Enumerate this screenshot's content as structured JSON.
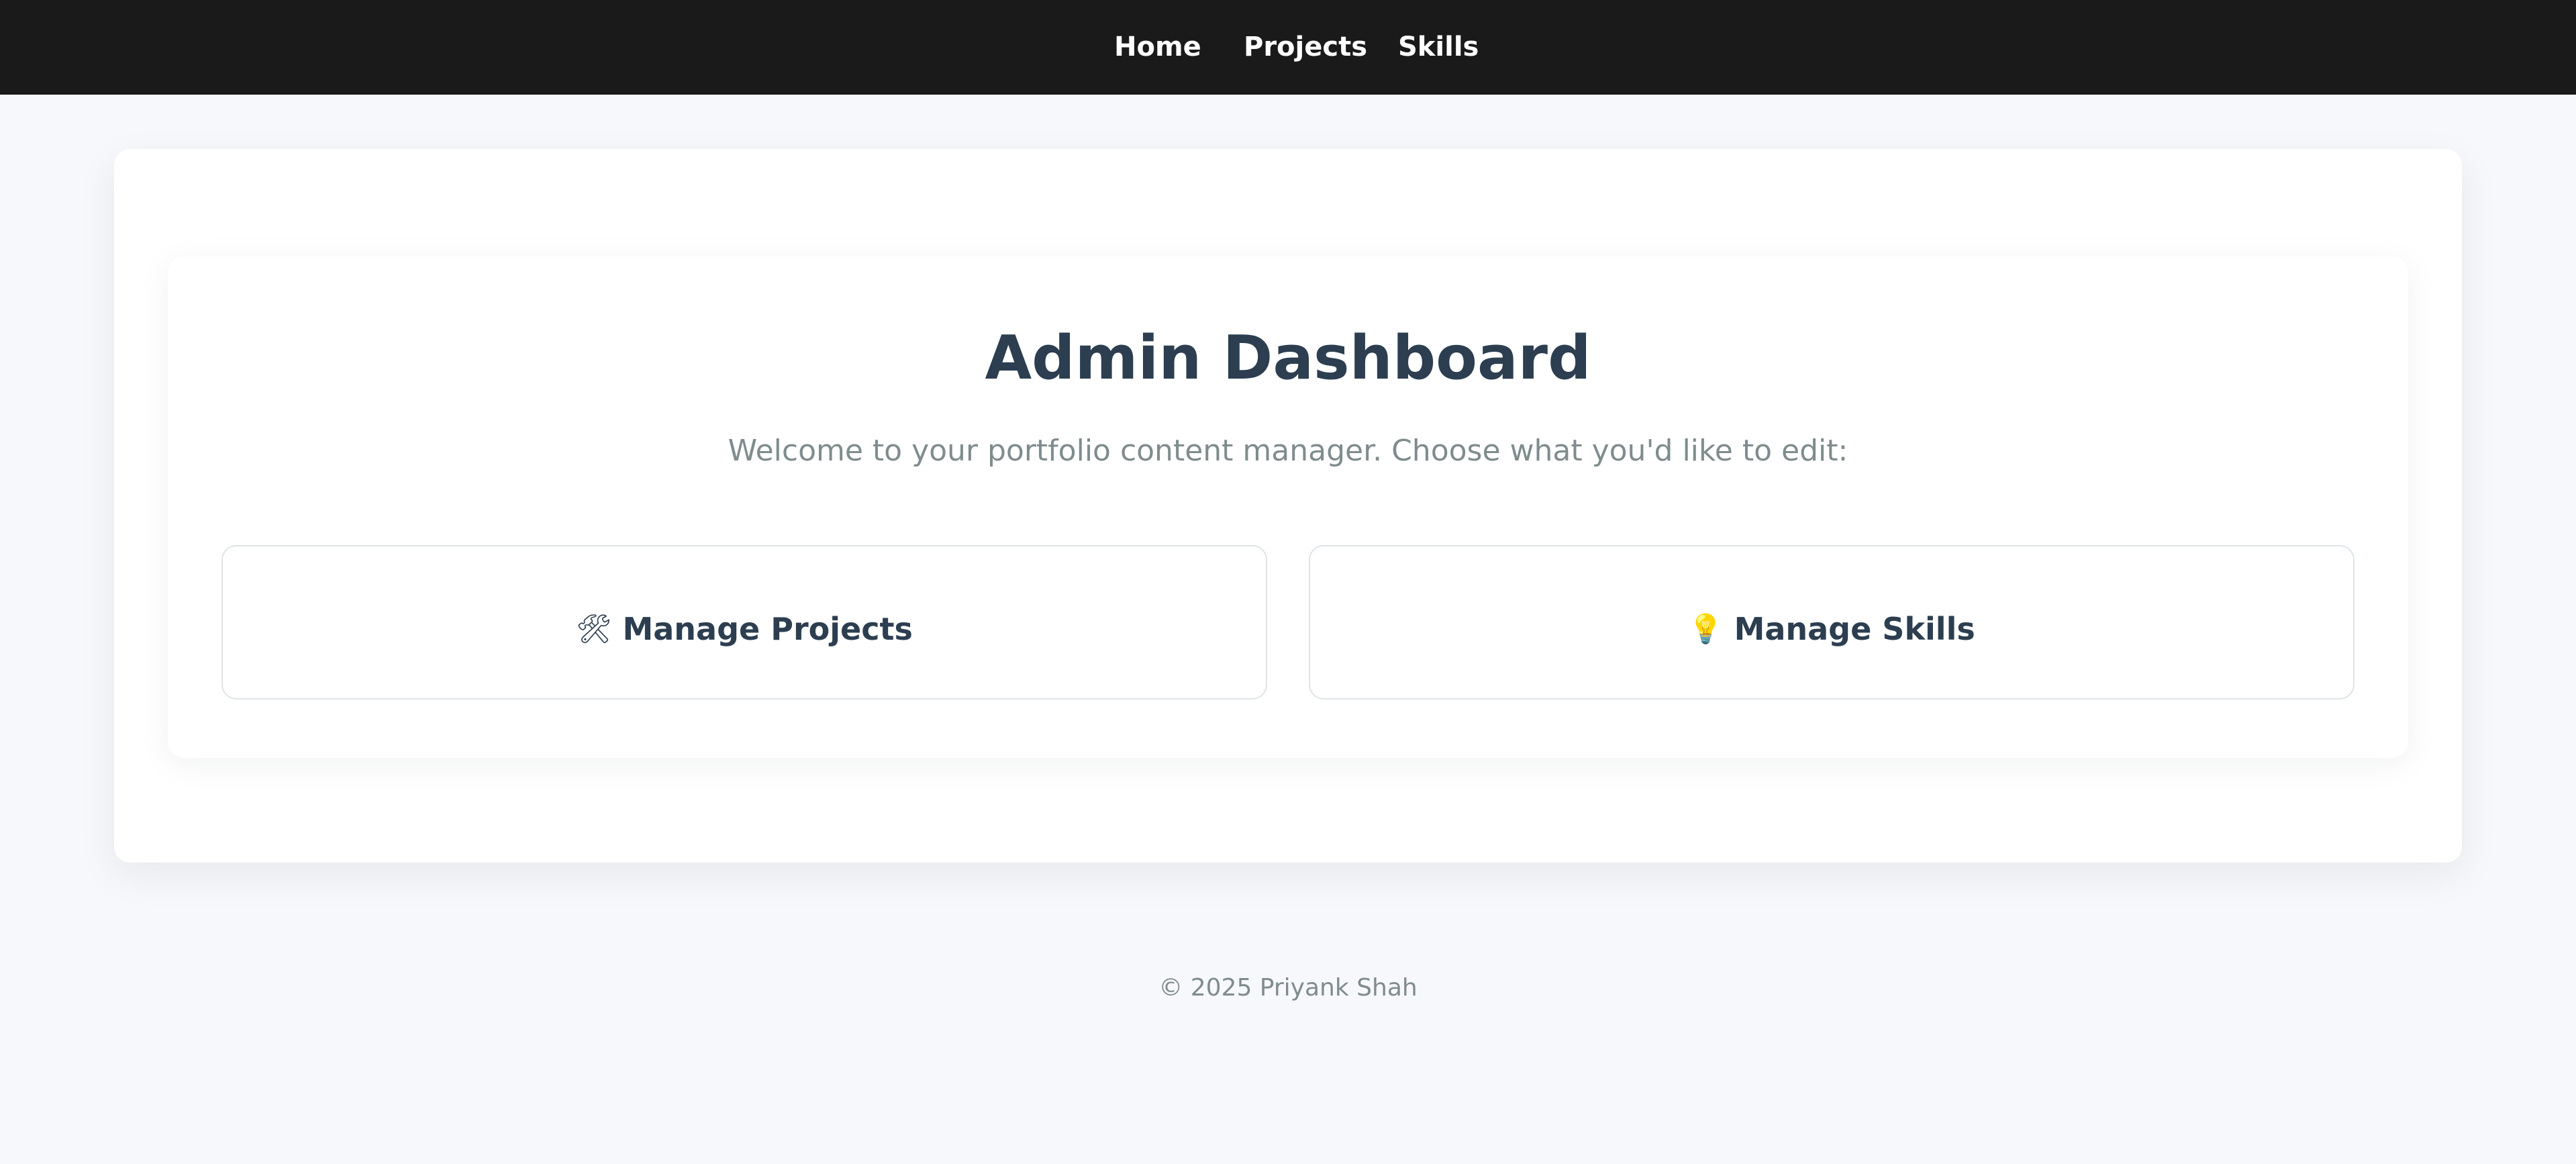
{
  "nav": {
    "items": [
      {
        "label": "Home"
      },
      {
        "label": "Projects"
      },
      {
        "label": "Skills"
      }
    ],
    "background": "#1a1a1a",
    "text_color": "#ffffff"
  },
  "dashboard": {
    "title": "Admin Dashboard",
    "subtitle": "Welcome to your portfolio content manager. Choose what you'd like to edit:",
    "actions": [
      {
        "icon": "hammer-and-wrench-icon",
        "glyph": "🛠",
        "label": "Manage Projects"
      },
      {
        "icon": "light-bulb-icon",
        "glyph": "💡",
        "label": "Manage Skills"
      }
    ]
  },
  "footer": {
    "text": "© 2025 Priyank Shah"
  },
  "colors": {
    "page_background": "#f7f8fb",
    "heading": "#2c3e50",
    "muted_text": "#7f8c8d"
  }
}
